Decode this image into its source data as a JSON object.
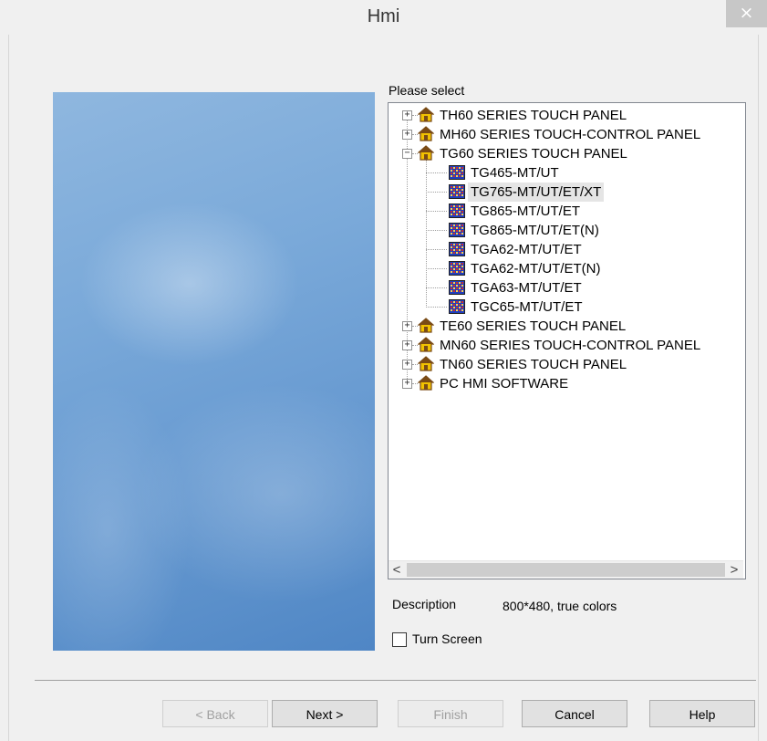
{
  "window": {
    "title": "Hmi",
    "close_label": "×"
  },
  "tree": {
    "label": "Please select",
    "items": [
      {
        "label": "TH60 SERIES TOUCH PANEL",
        "level": 0,
        "expander": "+"
      },
      {
        "label": "MH60 SERIES TOUCH-CONTROL PANEL",
        "level": 0,
        "expander": "+"
      },
      {
        "label": "TG60 SERIES TOUCH PANEL",
        "level": 0,
        "expander": "−"
      },
      {
        "label": "TG465-MT/UT",
        "level": 1
      },
      {
        "label": "TG765-MT/UT/ET/XT",
        "level": 1,
        "selected": true
      },
      {
        "label": "TG865-MT/UT/ET",
        "level": 1
      },
      {
        "label": "TG865-MT/UT/ET(N)",
        "level": 1
      },
      {
        "label": "TGA62-MT/UT/ET",
        "level": 1
      },
      {
        "label": "TGA62-MT/UT/ET(N)",
        "level": 1
      },
      {
        "label": "TGA63-MT/UT/ET",
        "level": 1
      },
      {
        "label": "TGC65-MT/UT/ET",
        "level": 1
      },
      {
        "label": "TE60 SERIES TOUCH PANEL",
        "level": 0,
        "expander": "+"
      },
      {
        "label": "MN60 SERIES TOUCH-CONTROL PANEL",
        "level": 0,
        "expander": "+"
      },
      {
        "label": "TN60 SERIES TOUCH PANEL",
        "level": 0,
        "expander": "+"
      },
      {
        "label": "PC HMI SOFTWARE",
        "level": 0,
        "expander": "+"
      }
    ],
    "scroll_left": "<",
    "scroll_right": ">"
  },
  "description": {
    "label": "Description",
    "value": "800*480, true colors"
  },
  "turn_screen": {
    "label": "Turn Screen",
    "checked": false
  },
  "buttons": {
    "back": "< Back",
    "next": "Next >",
    "finish": "Finish",
    "cancel": "Cancel",
    "help": "Help"
  },
  "colors": {
    "house_roof": "#7a4b16",
    "house_body": "#f2c200",
    "panel_grid": "#1f3fbf",
    "panel_cells": "#d22d2d"
  }
}
